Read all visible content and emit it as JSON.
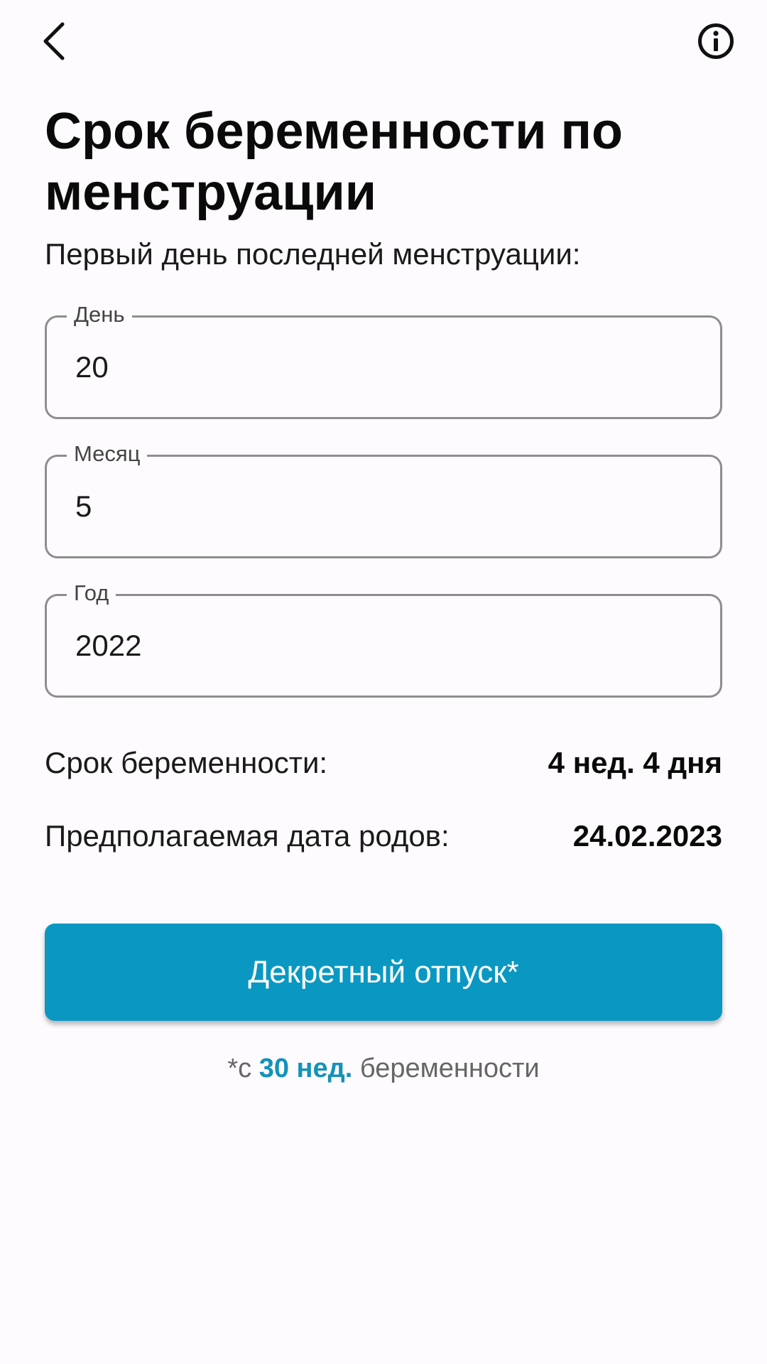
{
  "header": {
    "back_icon": "chevron-left-icon",
    "info_icon": "info-circle-icon"
  },
  "page": {
    "title": "Срок беременности по менструации",
    "subtitle": "Первый день последней менструации:"
  },
  "fields": {
    "day": {
      "label": "День",
      "value": "20"
    },
    "month": {
      "label": "Месяц",
      "value": "5"
    },
    "year": {
      "label": "Год",
      "value": "2022"
    }
  },
  "results": {
    "term": {
      "label": "Срок беременности:",
      "value": "4 нед. 4 дня"
    },
    "due_date": {
      "label": "Предполагаемая дата родов:",
      "value": "24.02.2023"
    }
  },
  "action": {
    "button_label": "Декретный отпуск*"
  },
  "footnote": {
    "prefix": "*с ",
    "highlight": "30 нед.",
    "suffix": " беременности"
  },
  "colors": {
    "background": "#fefbfe",
    "accent": "#0a98c2",
    "accent_text": "#1492b9",
    "field_border": "#8e8e8e"
  }
}
